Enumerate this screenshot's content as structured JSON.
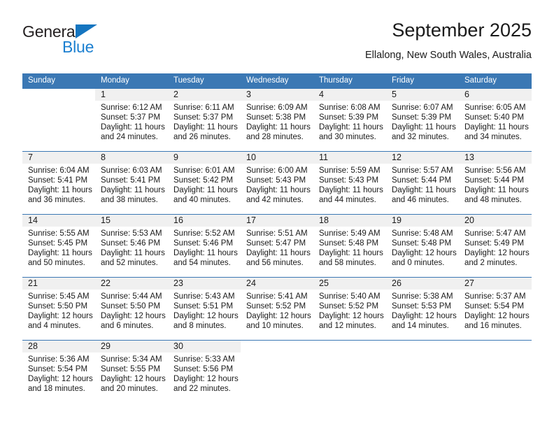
{
  "brand": {
    "name_top": "General",
    "name_bottom": "Blue",
    "triangle_color": "#1575c0",
    "top_color": "#231f20",
    "bottom_color": "#1b7fd0"
  },
  "header": {
    "title": "September 2025",
    "subtitle": "Ellalong, New South Wales, Australia"
  },
  "theme": {
    "header_bg": "#3b78b4",
    "header_text": "#ffffff",
    "daynum_bg": "#f0f0f0",
    "row_border": "#3b78b4",
    "text": "#1a1a1a"
  },
  "weekdays": [
    "Sunday",
    "Monday",
    "Tuesday",
    "Wednesday",
    "Thursday",
    "Friday",
    "Saturday"
  ],
  "weeks": [
    [
      {
        "day": "",
        "sunrise": "",
        "sunset": "",
        "daylight_1": "",
        "daylight_2": ""
      },
      {
        "day": "1",
        "sunrise": "Sunrise: 6:12 AM",
        "sunset": "Sunset: 5:37 PM",
        "daylight_1": "Daylight: 11 hours",
        "daylight_2": "and 24 minutes."
      },
      {
        "day": "2",
        "sunrise": "Sunrise: 6:11 AM",
        "sunset": "Sunset: 5:37 PM",
        "daylight_1": "Daylight: 11 hours",
        "daylight_2": "and 26 minutes."
      },
      {
        "day": "3",
        "sunrise": "Sunrise: 6:09 AM",
        "sunset": "Sunset: 5:38 PM",
        "daylight_1": "Daylight: 11 hours",
        "daylight_2": "and 28 minutes."
      },
      {
        "day": "4",
        "sunrise": "Sunrise: 6:08 AM",
        "sunset": "Sunset: 5:39 PM",
        "daylight_1": "Daylight: 11 hours",
        "daylight_2": "and 30 minutes."
      },
      {
        "day": "5",
        "sunrise": "Sunrise: 6:07 AM",
        "sunset": "Sunset: 5:39 PM",
        "daylight_1": "Daylight: 11 hours",
        "daylight_2": "and 32 minutes."
      },
      {
        "day": "6",
        "sunrise": "Sunrise: 6:05 AM",
        "sunset": "Sunset: 5:40 PM",
        "daylight_1": "Daylight: 11 hours",
        "daylight_2": "and 34 minutes."
      }
    ],
    [
      {
        "day": "7",
        "sunrise": "Sunrise: 6:04 AM",
        "sunset": "Sunset: 5:41 PM",
        "daylight_1": "Daylight: 11 hours",
        "daylight_2": "and 36 minutes."
      },
      {
        "day": "8",
        "sunrise": "Sunrise: 6:03 AM",
        "sunset": "Sunset: 5:41 PM",
        "daylight_1": "Daylight: 11 hours",
        "daylight_2": "and 38 minutes."
      },
      {
        "day": "9",
        "sunrise": "Sunrise: 6:01 AM",
        "sunset": "Sunset: 5:42 PM",
        "daylight_1": "Daylight: 11 hours",
        "daylight_2": "and 40 minutes."
      },
      {
        "day": "10",
        "sunrise": "Sunrise: 6:00 AM",
        "sunset": "Sunset: 5:43 PM",
        "daylight_1": "Daylight: 11 hours",
        "daylight_2": "and 42 minutes."
      },
      {
        "day": "11",
        "sunrise": "Sunrise: 5:59 AM",
        "sunset": "Sunset: 5:43 PM",
        "daylight_1": "Daylight: 11 hours",
        "daylight_2": "and 44 minutes."
      },
      {
        "day": "12",
        "sunrise": "Sunrise: 5:57 AM",
        "sunset": "Sunset: 5:44 PM",
        "daylight_1": "Daylight: 11 hours",
        "daylight_2": "and 46 minutes."
      },
      {
        "day": "13",
        "sunrise": "Sunrise: 5:56 AM",
        "sunset": "Sunset: 5:44 PM",
        "daylight_1": "Daylight: 11 hours",
        "daylight_2": "and 48 minutes."
      }
    ],
    [
      {
        "day": "14",
        "sunrise": "Sunrise: 5:55 AM",
        "sunset": "Sunset: 5:45 PM",
        "daylight_1": "Daylight: 11 hours",
        "daylight_2": "and 50 minutes."
      },
      {
        "day": "15",
        "sunrise": "Sunrise: 5:53 AM",
        "sunset": "Sunset: 5:46 PM",
        "daylight_1": "Daylight: 11 hours",
        "daylight_2": "and 52 minutes."
      },
      {
        "day": "16",
        "sunrise": "Sunrise: 5:52 AM",
        "sunset": "Sunset: 5:46 PM",
        "daylight_1": "Daylight: 11 hours",
        "daylight_2": "and 54 minutes."
      },
      {
        "day": "17",
        "sunrise": "Sunrise: 5:51 AM",
        "sunset": "Sunset: 5:47 PM",
        "daylight_1": "Daylight: 11 hours",
        "daylight_2": "and 56 minutes."
      },
      {
        "day": "18",
        "sunrise": "Sunrise: 5:49 AM",
        "sunset": "Sunset: 5:48 PM",
        "daylight_1": "Daylight: 11 hours",
        "daylight_2": "and 58 minutes."
      },
      {
        "day": "19",
        "sunrise": "Sunrise: 5:48 AM",
        "sunset": "Sunset: 5:48 PM",
        "daylight_1": "Daylight: 12 hours",
        "daylight_2": "and 0 minutes."
      },
      {
        "day": "20",
        "sunrise": "Sunrise: 5:47 AM",
        "sunset": "Sunset: 5:49 PM",
        "daylight_1": "Daylight: 12 hours",
        "daylight_2": "and 2 minutes."
      }
    ],
    [
      {
        "day": "21",
        "sunrise": "Sunrise: 5:45 AM",
        "sunset": "Sunset: 5:50 PM",
        "daylight_1": "Daylight: 12 hours",
        "daylight_2": "and 4 minutes."
      },
      {
        "day": "22",
        "sunrise": "Sunrise: 5:44 AM",
        "sunset": "Sunset: 5:50 PM",
        "daylight_1": "Daylight: 12 hours",
        "daylight_2": "and 6 minutes."
      },
      {
        "day": "23",
        "sunrise": "Sunrise: 5:43 AM",
        "sunset": "Sunset: 5:51 PM",
        "daylight_1": "Daylight: 12 hours",
        "daylight_2": "and 8 minutes."
      },
      {
        "day": "24",
        "sunrise": "Sunrise: 5:41 AM",
        "sunset": "Sunset: 5:52 PM",
        "daylight_1": "Daylight: 12 hours",
        "daylight_2": "and 10 minutes."
      },
      {
        "day": "25",
        "sunrise": "Sunrise: 5:40 AM",
        "sunset": "Sunset: 5:52 PM",
        "daylight_1": "Daylight: 12 hours",
        "daylight_2": "and 12 minutes."
      },
      {
        "day": "26",
        "sunrise": "Sunrise: 5:38 AM",
        "sunset": "Sunset: 5:53 PM",
        "daylight_1": "Daylight: 12 hours",
        "daylight_2": "and 14 minutes."
      },
      {
        "day": "27",
        "sunrise": "Sunrise: 5:37 AM",
        "sunset": "Sunset: 5:54 PM",
        "daylight_1": "Daylight: 12 hours",
        "daylight_2": "and 16 minutes."
      }
    ],
    [
      {
        "day": "28",
        "sunrise": "Sunrise: 5:36 AM",
        "sunset": "Sunset: 5:54 PM",
        "daylight_1": "Daylight: 12 hours",
        "daylight_2": "and 18 minutes."
      },
      {
        "day": "29",
        "sunrise": "Sunrise: 5:34 AM",
        "sunset": "Sunset: 5:55 PM",
        "daylight_1": "Daylight: 12 hours",
        "daylight_2": "and 20 minutes."
      },
      {
        "day": "30",
        "sunrise": "Sunrise: 5:33 AM",
        "sunset": "Sunset: 5:56 PM",
        "daylight_1": "Daylight: 12 hours",
        "daylight_2": "and 22 minutes."
      },
      {
        "day": "",
        "sunrise": "",
        "sunset": "",
        "daylight_1": "",
        "daylight_2": ""
      },
      {
        "day": "",
        "sunrise": "",
        "sunset": "",
        "daylight_1": "",
        "daylight_2": ""
      },
      {
        "day": "",
        "sunrise": "",
        "sunset": "",
        "daylight_1": "",
        "daylight_2": ""
      },
      {
        "day": "",
        "sunrise": "",
        "sunset": "",
        "daylight_1": "",
        "daylight_2": ""
      }
    ]
  ]
}
